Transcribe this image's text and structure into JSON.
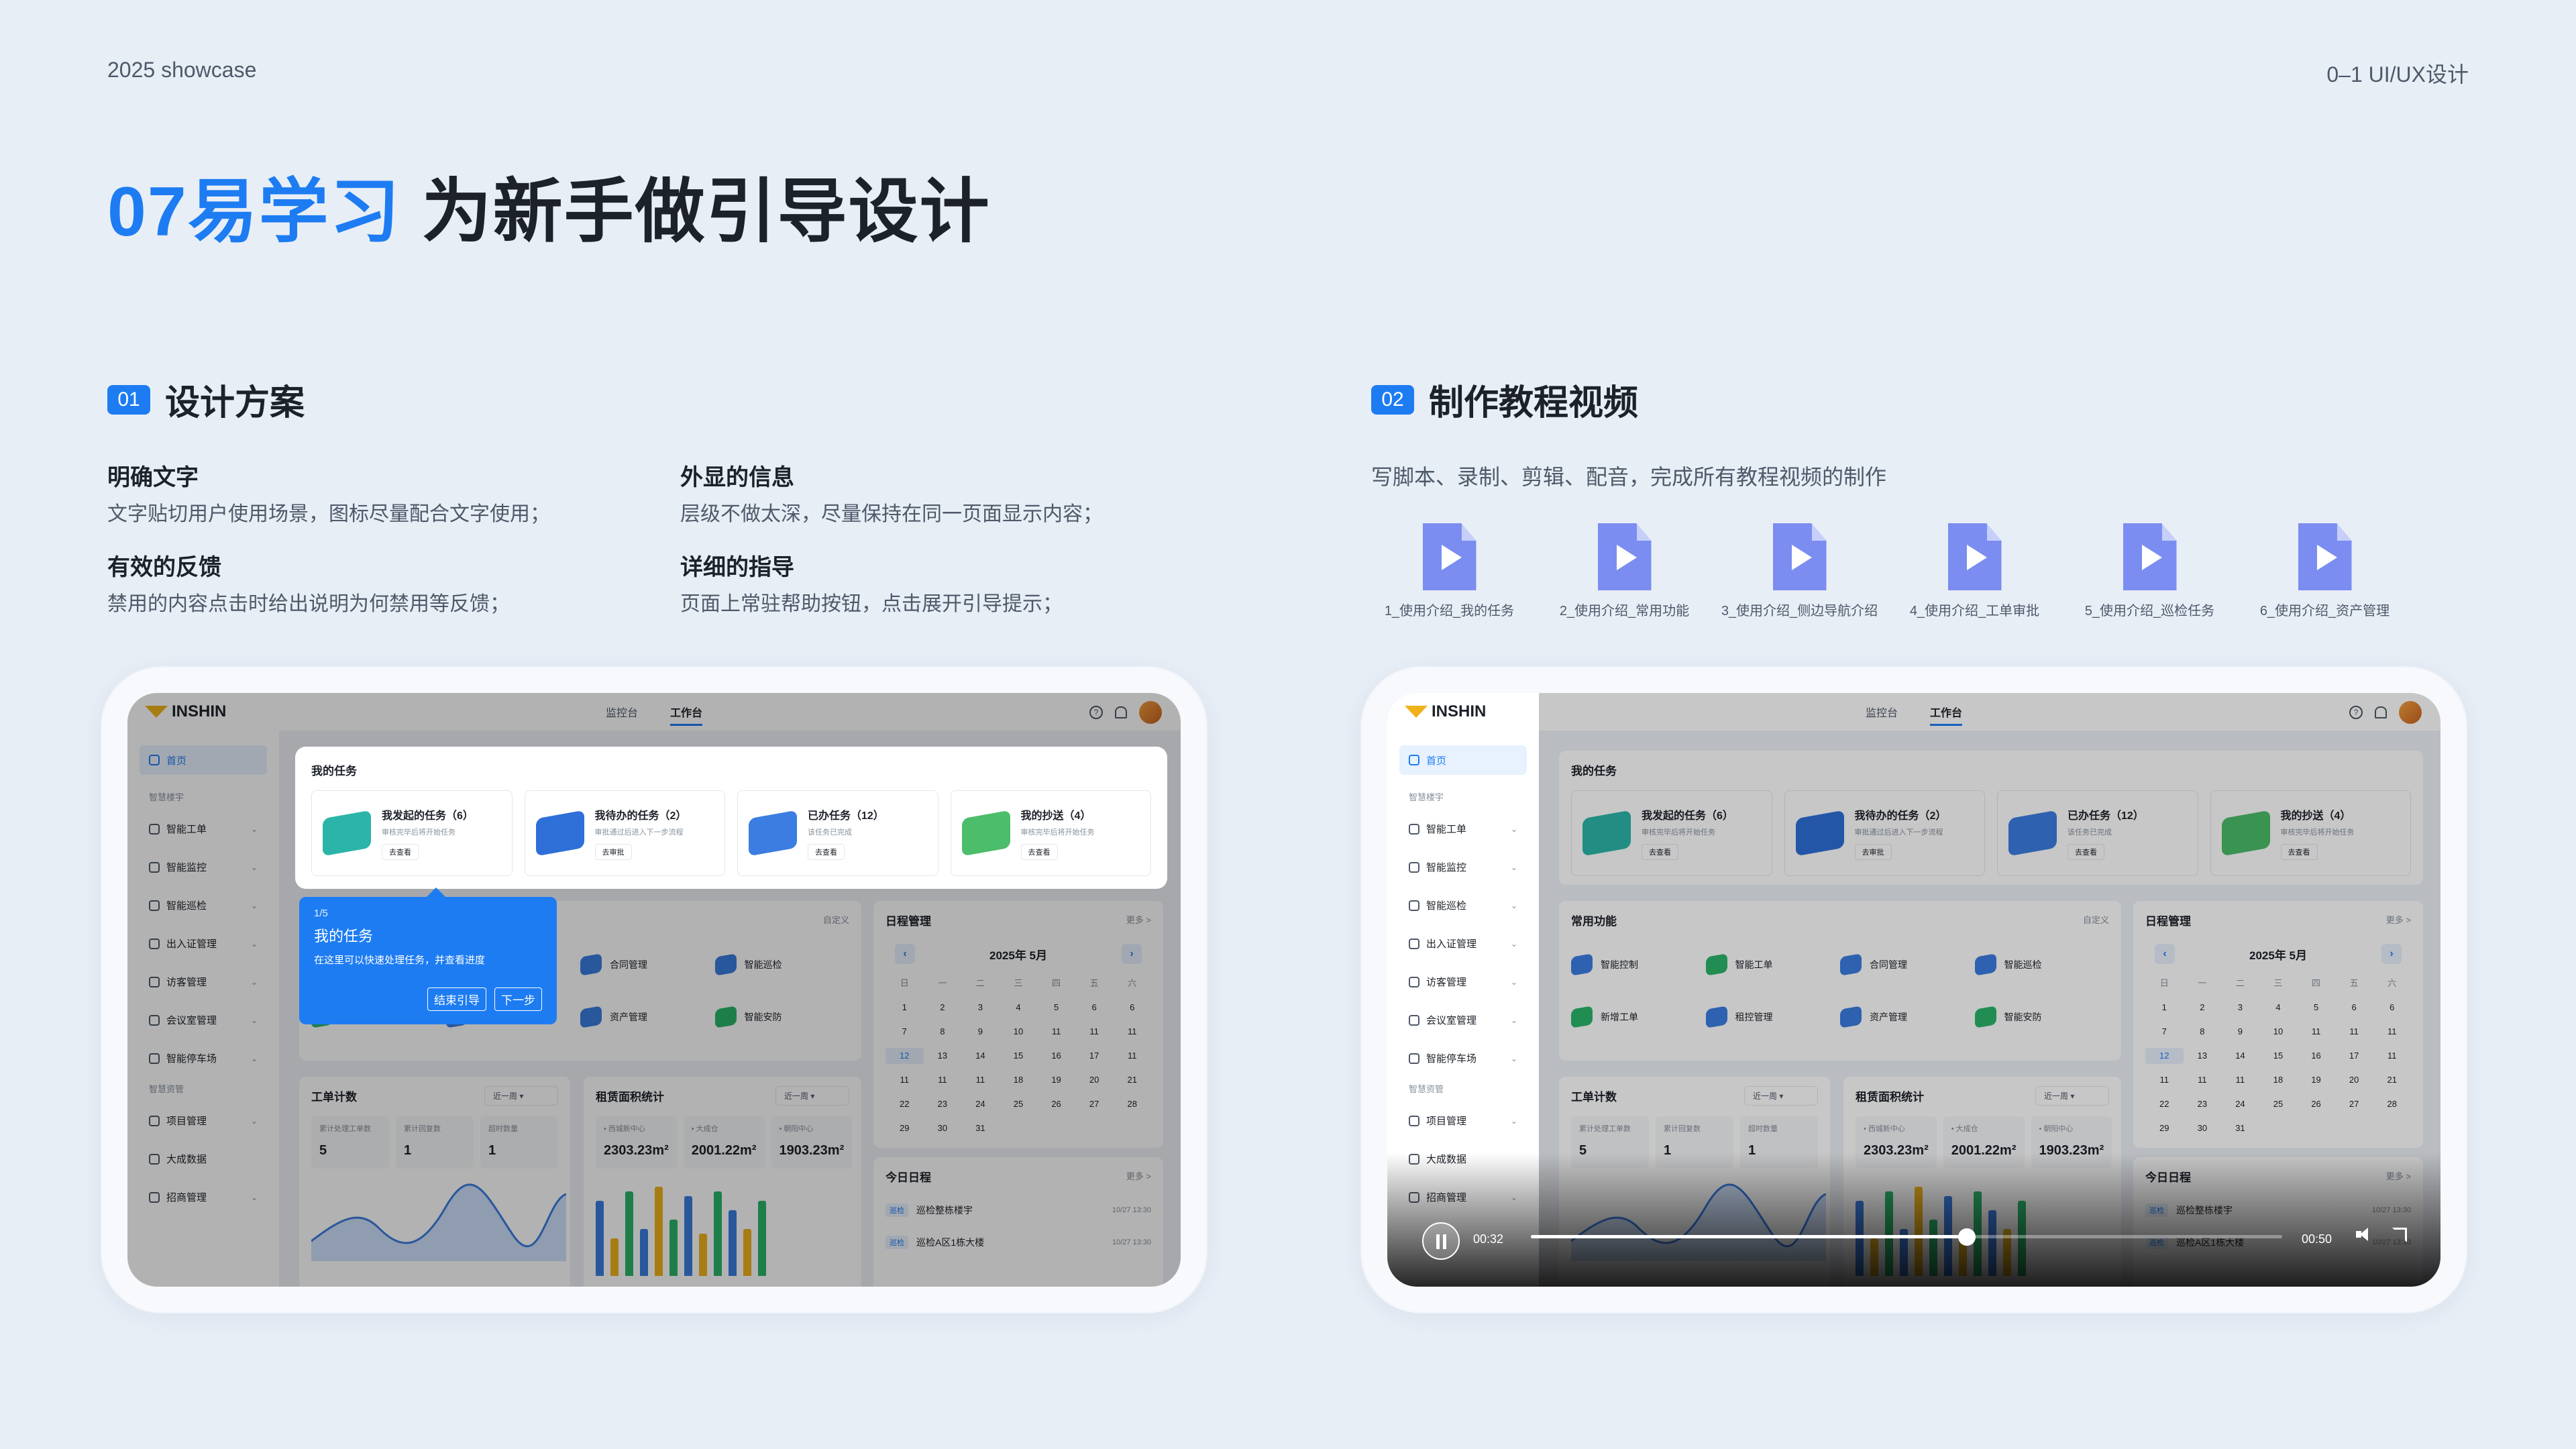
{
  "header": {
    "left": "2025 showcase",
    "right": "0–1 UI/UX设计"
  },
  "title": {
    "accent": "07易学习",
    "rest": "为新手做引导设计"
  },
  "section1": {
    "num": "01",
    "title": "设计方案",
    "points": [
      {
        "title": "明确文字",
        "desc": "文字贴切用户使用场景，图标尽量配合文字使用；"
      },
      {
        "title": "外显的信息",
        "desc": "层级不做太深，尽量保持在同一页面显示内容；"
      },
      {
        "title": "有效的反馈",
        "desc": "禁用的内容点击时给出说明为何禁用等反馈；"
      },
      {
        "title": "详细的指导",
        "desc": "页面上常驻帮助按钮，点击展开引导提示；"
      }
    ]
  },
  "section2": {
    "num": "02",
    "title": "制作教程视频",
    "desc": "写脚本、录制、剪辑、配音，完成所有教程视频的制作",
    "videos": [
      "1_使用介绍_我的任务",
      "2_使用介绍_常用功能",
      "3_使用介绍_侧边导航介绍",
      "4_使用介绍_工单审批",
      "5_使用介绍_巡检任务",
      "6_使用介绍_资产管理"
    ]
  },
  "app": {
    "logo": "INSHIN",
    "tabs": [
      "监控台",
      "工作台"
    ],
    "home": "首页",
    "group1": "智慧楼宇",
    "menu1": [
      "智能工单",
      "智能监控",
      "智能巡检",
      "出入证管理",
      "访客管理",
      "会议室管理",
      "智能停车场"
    ],
    "group2": "智慧资管",
    "menu2": [
      "项目管理",
      "大成数据",
      "招商管理"
    ],
    "tasks_title": "我的任务",
    "tasks": [
      {
        "title": "我发起的任务（6）",
        "sub": "审核完毕后将开始任务",
        "btn": "去查看",
        "color": "#2bb5a8"
      },
      {
        "title": "我待办的任务（2）",
        "sub": "审批通过后进入下一步流程",
        "btn": "去审批",
        "color": "#2f6fd8"
      },
      {
        "title": "已办任务（12）",
        "sub": "该任务已完成",
        "btn": "去查看",
        "color": "#3b7de0"
      },
      {
        "title": "我的抄送（4）",
        "sub": "审核完毕后将开始任务",
        "btn": "去查看",
        "color": "#4cbd6a"
      }
    ],
    "common_title": "常用功能",
    "customize": "自定义",
    "functions": [
      {
        "label": "智能控制",
        "color": "#3b7de0"
      },
      {
        "label": "智能工单",
        "color": "#2bb56a"
      },
      {
        "label": "合同管理",
        "color": "#3b7de0"
      },
      {
        "label": "智能巡检",
        "color": "#3b7de0"
      },
      {
        "label": "新增工单",
        "color": "#2bb56a"
      },
      {
        "label": "租控管理",
        "color": "#3b7de0"
      },
      {
        "label": "资产管理",
        "color": "#3b7de0"
      },
      {
        "label": "智能安防",
        "color": "#2bb56a"
      }
    ],
    "schedule_title": "日程管理",
    "more": "更多 >",
    "month": "2025年 5月",
    "weekdays": [
      "日",
      "一",
      "二",
      "三",
      "四",
      "五",
      "六"
    ],
    "days": [
      "1",
      "2",
      "3",
      "4",
      "5",
      "6",
      "6",
      "7",
      "8",
      "9",
      "10",
      "11",
      "11",
      "11",
      "12",
      "13",
      "14",
      "15",
      "16",
      "17",
      "11",
      "11",
      "11",
      "11",
      "18",
      "19",
      "20",
      "21",
      "22",
      "23",
      "24",
      "25",
      "26",
      "27",
      "28",
      "29",
      "30",
      "31"
    ],
    "today_title": "今日日程",
    "schedules": [
      {
        "tag": "巡检",
        "text": "巡检整栋楼宇",
        "time": "10/27 13:30"
      },
      {
        "tag": "巡检",
        "text": "巡检A区1栋大楼",
        "time": "10/27 13:30"
      }
    ],
    "orders_title": "工单计数",
    "range": "近一周",
    "order_stats": [
      {
        "k": "累计处理工单数",
        "v": "5"
      },
      {
        "k": "累计回复数",
        "v": "1"
      },
      {
        "k": "超时数量",
        "v": "1"
      }
    ],
    "area_title": "租赁面积统计",
    "area_stats": [
      {
        "k": "• 西城新中心",
        "v": "2303.23m²"
      },
      {
        "k": "• 大成仓",
        "v": "2001.22m²"
      },
      {
        "k": "• 朝阳中心",
        "v": "1903.23m²"
      }
    ]
  },
  "guide": {
    "step": "1/5",
    "title": "我的任务",
    "desc": "在这里可以快速处理任务，并查看进度",
    "end": "结束引导",
    "next": "下一步"
  },
  "player": {
    "current": "00:32",
    "total": "00:50",
    "progress": 0.58
  }
}
